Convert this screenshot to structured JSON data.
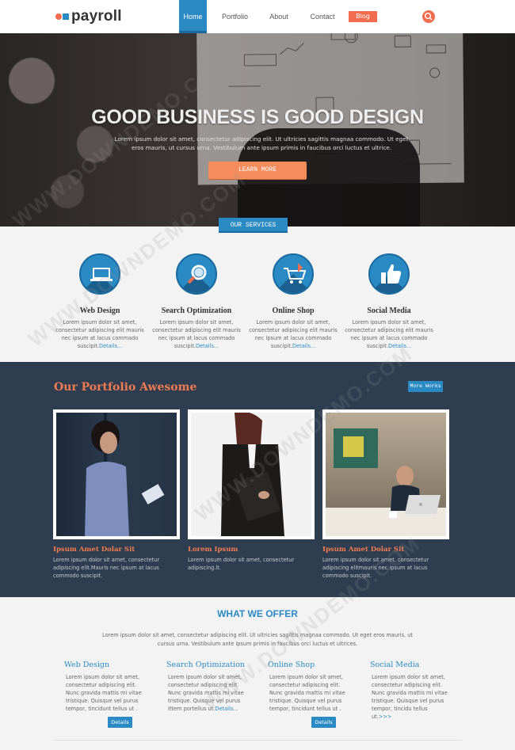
{
  "logo": {
    "text": "payroll"
  },
  "nav": {
    "items": [
      {
        "label": "Home",
        "active": true
      },
      {
        "label": "Portfolio"
      },
      {
        "label": "About"
      },
      {
        "label": "Contact"
      }
    ],
    "blog": "Blog"
  },
  "hero": {
    "title": "GOOD BUSINESS IS GOOD DESIGN",
    "text": "Lorem ipsum dolor sit amet, consectetur adipiscing elit. Ut ultricies sagittis magnaa commodo. Ut eget eros mauris, ut cursus urna. Vestibulum ante ipsum primis in faucibus orci luctus et ultrice.",
    "button": "LEARN MORE",
    "slides": 5,
    "active_slide": 3
  },
  "services": {
    "badge": "OUR SERVICES",
    "items": [
      {
        "icon": "laptop-icon",
        "title": "Web Design",
        "text": "Lorem ipsum dolor sit amet, consectetur adipiscing elit mauris nec ipsum at lacus commado suscipit.",
        "link": "Details..."
      },
      {
        "icon": "magnifier-icon",
        "title": "Search Optimization",
        "text": "Lorem ipsum dolor sit amet, consectetur adipiscing elit mauris nec ipsum at lacus commado suscipit.",
        "link": "Details..."
      },
      {
        "icon": "cart-icon",
        "title": "Online Shop",
        "text": "Lorem ipsum dolor sit amet, consectetur adipiscing elit mauris nec ipsum at lacus commado suscipit.",
        "link": "Details..."
      },
      {
        "icon": "thumbs-up-icon",
        "title": "Social Media",
        "text": "Lorem ipsum dolor sit amet, consectetur adipiscing elit mauris nec ipsum at lacus commado suscipit.",
        "link": "Details..."
      }
    ]
  },
  "portfolio": {
    "title": "Our Portfolio Awesome",
    "more": "More Works",
    "items": [
      {
        "title": "Ipsum Amet Dolar Sit",
        "text": "Lorem ipsum dolor sit amet, consectetur adipiscing elit.Mauris nec ipsum at lacus commodo suscipit."
      },
      {
        "title": "Lorem Ipsum",
        "text": "Lorem ipsum dolor sit amet, consectetur adipiscing.lt."
      },
      {
        "title": "Ipsum Amet Dolar Sit",
        "text": "Lorem ipsum dolor sit amet, consectetur adipiscing elitmauris nec ipsum at lacus commodo suscipit."
      }
    ]
  },
  "offer": {
    "title": "WHAT WE OFFER",
    "text": "Lorem ipsum dolor sit amet, consectetur adipiscing elit. Ut ultricies sagittis magnaa commodo. Ut eget eros mauris, ut cursus urna. Vestibulum ante ipsum primis in faucibus orci luctus et ultrices.",
    "columns": [
      {
        "title": "Web Design",
        "text": "Lorem ipsum dolor sit amet, consectetur adipiscing elit. Nunc gravida mattis mi vitae tristique. Quisque vel purus tempor, tincidunt tellus ut .",
        "link": ""
      },
      {
        "title": "Search Optimization",
        "text": "Lorem ipsum dolor sit amet, consectetur adipiscing elit. Nunc gravida mattis mi vitae tristique. Quisque vel purus ittem portellus ut.",
        "link": "Details..."
      },
      {
        "title": "Online Shop",
        "text": "Lorem ipsum dolor sit amet, consectetur adipiscing elit. Nunc gravida mattis mi vitae tristique. Quisque vel purus tempor, tincidunt tellus ut .",
        "link": ""
      },
      {
        "title": "Social Media",
        "text": "Lorem ipsum dolor sit amet, consectetur adipiscing elit. Nunc gravida mattis mi vitae tristique. Quisque vel purus tempor, tincidu tellus ut.",
        "link": ">>>"
      }
    ],
    "buttons": [
      "Details",
      "Details"
    ]
  },
  "watermark": "WWW.DOWNDEMO.COM",
  "colors": {
    "accent_blue": "#2a8ac4",
    "accent_orange": "#f26c4f",
    "dark_band": "#2e3e50"
  }
}
